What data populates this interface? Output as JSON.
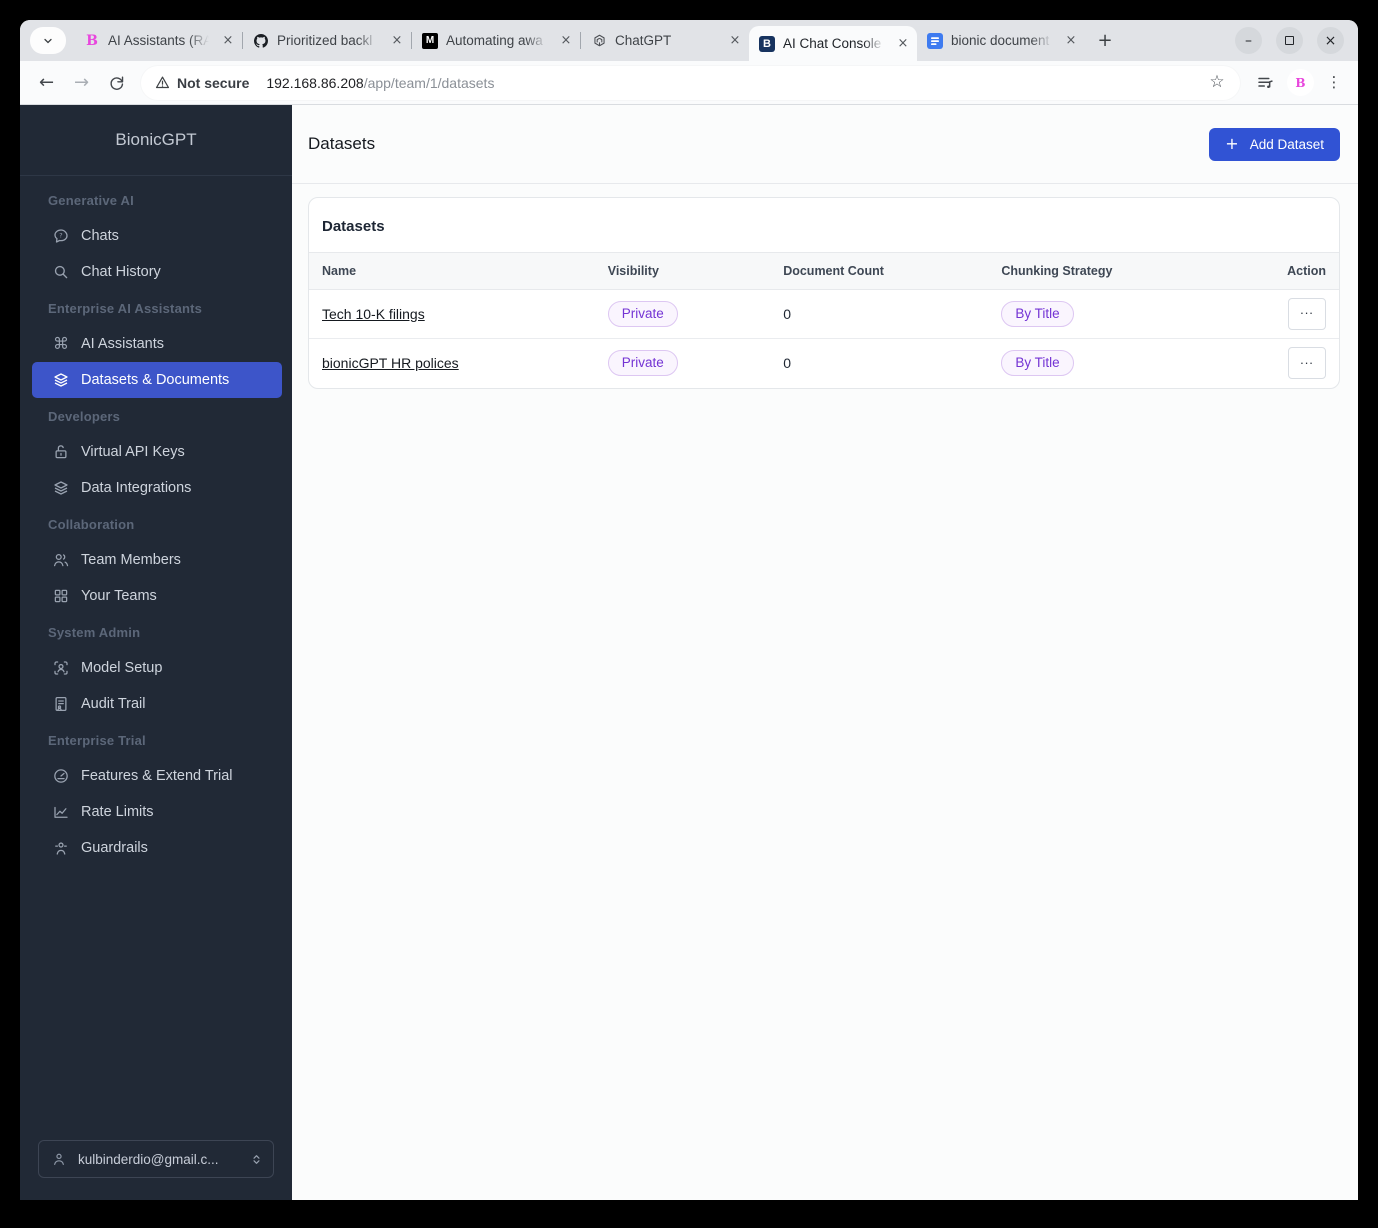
{
  "browser": {
    "tabs": [
      {
        "title": "AI Assistants (RA",
        "favicon": "bionicgpt-b-icon",
        "favicon_letter": "B"
      },
      {
        "title": "Prioritized backl",
        "favicon": "github-icon"
      },
      {
        "title": "Automating awa",
        "favicon": "medium-icon",
        "favicon_letter": "M"
      },
      {
        "title": "ChatGPT",
        "favicon": "chatgpt-icon"
      },
      {
        "title": "AI Chat Console",
        "favicon": "bionic-console-icon",
        "favicon_letter": "B",
        "active": true
      },
      {
        "title": "bionic document",
        "favicon": "document-icon"
      }
    ],
    "toolbar": {
      "security_label": "Not secure",
      "url_host": "192.168.86.208",
      "url_path": "/app/team/1/datasets",
      "extension_letter": "B"
    }
  },
  "icons": {
    "back": "←",
    "forward": "→",
    "star": "☆",
    "kebab": "⋮",
    "close": "×",
    "minimize": "–",
    "new_tab": "+",
    "plus": "+",
    "command": "⌘"
  },
  "sidebar": {
    "brand": "BionicGPT",
    "sections": [
      {
        "label": "Generative AI",
        "items": [
          {
            "label": "Chats",
            "icon": "chat-icon"
          },
          {
            "label": "Chat History",
            "icon": "search-icon"
          }
        ]
      },
      {
        "label": "Enterprise AI Assistants",
        "items": [
          {
            "label": "AI Assistants",
            "icon": "command-icon"
          },
          {
            "label": "Datasets & Documents",
            "icon": "layers-icon",
            "active": true
          }
        ]
      },
      {
        "label": "Developers",
        "items": [
          {
            "label": "Virtual API Keys",
            "icon": "lock-open-icon"
          },
          {
            "label": "Data Integrations",
            "icon": "layers-icon"
          }
        ]
      },
      {
        "label": "Collaboration",
        "items": [
          {
            "label": "Team Members",
            "icon": "users-icon"
          },
          {
            "label": "Your Teams",
            "icon": "grid-icon"
          }
        ]
      },
      {
        "label": "System Admin",
        "items": [
          {
            "label": "Model Setup",
            "icon": "scan-user-icon"
          },
          {
            "label": "Audit Trail",
            "icon": "document-user-icon"
          }
        ]
      },
      {
        "label": "Enterprise Trial",
        "items": [
          {
            "label": "Features & Extend Trial",
            "icon": "gauge-icon"
          },
          {
            "label": "Rate Limits",
            "icon": "chart-icon"
          },
          {
            "label": "Guardrails",
            "icon": "guard-user-icon"
          }
        ]
      }
    ],
    "user_email": "kulbinderdio@gmail.c..."
  },
  "main": {
    "page_title": "Datasets",
    "add_button_label": "Add Dataset",
    "card": {
      "title": "Datasets",
      "columns": [
        "Name",
        "Visibility",
        "Document Count",
        "Chunking Strategy",
        "Action"
      ],
      "rows": [
        {
          "name": "Tech 10-K filings",
          "visibility": "Private",
          "document_count": "0",
          "chunking_strategy": "By Title",
          "action": "..."
        },
        {
          "name": "bionicGPT HR polices",
          "visibility": "Private",
          "document_count": "0",
          "chunking_strategy": "By Title",
          "action": "..."
        }
      ]
    }
  },
  "colors": {
    "accent_blue": "#3153d4",
    "sidebar_active_blue": "#3d55c9",
    "sidebar_bg": "#212936",
    "badge_text": "#7434d4",
    "badge_bg": "#faf5fe",
    "badge_border": "#ddc7f2"
  }
}
